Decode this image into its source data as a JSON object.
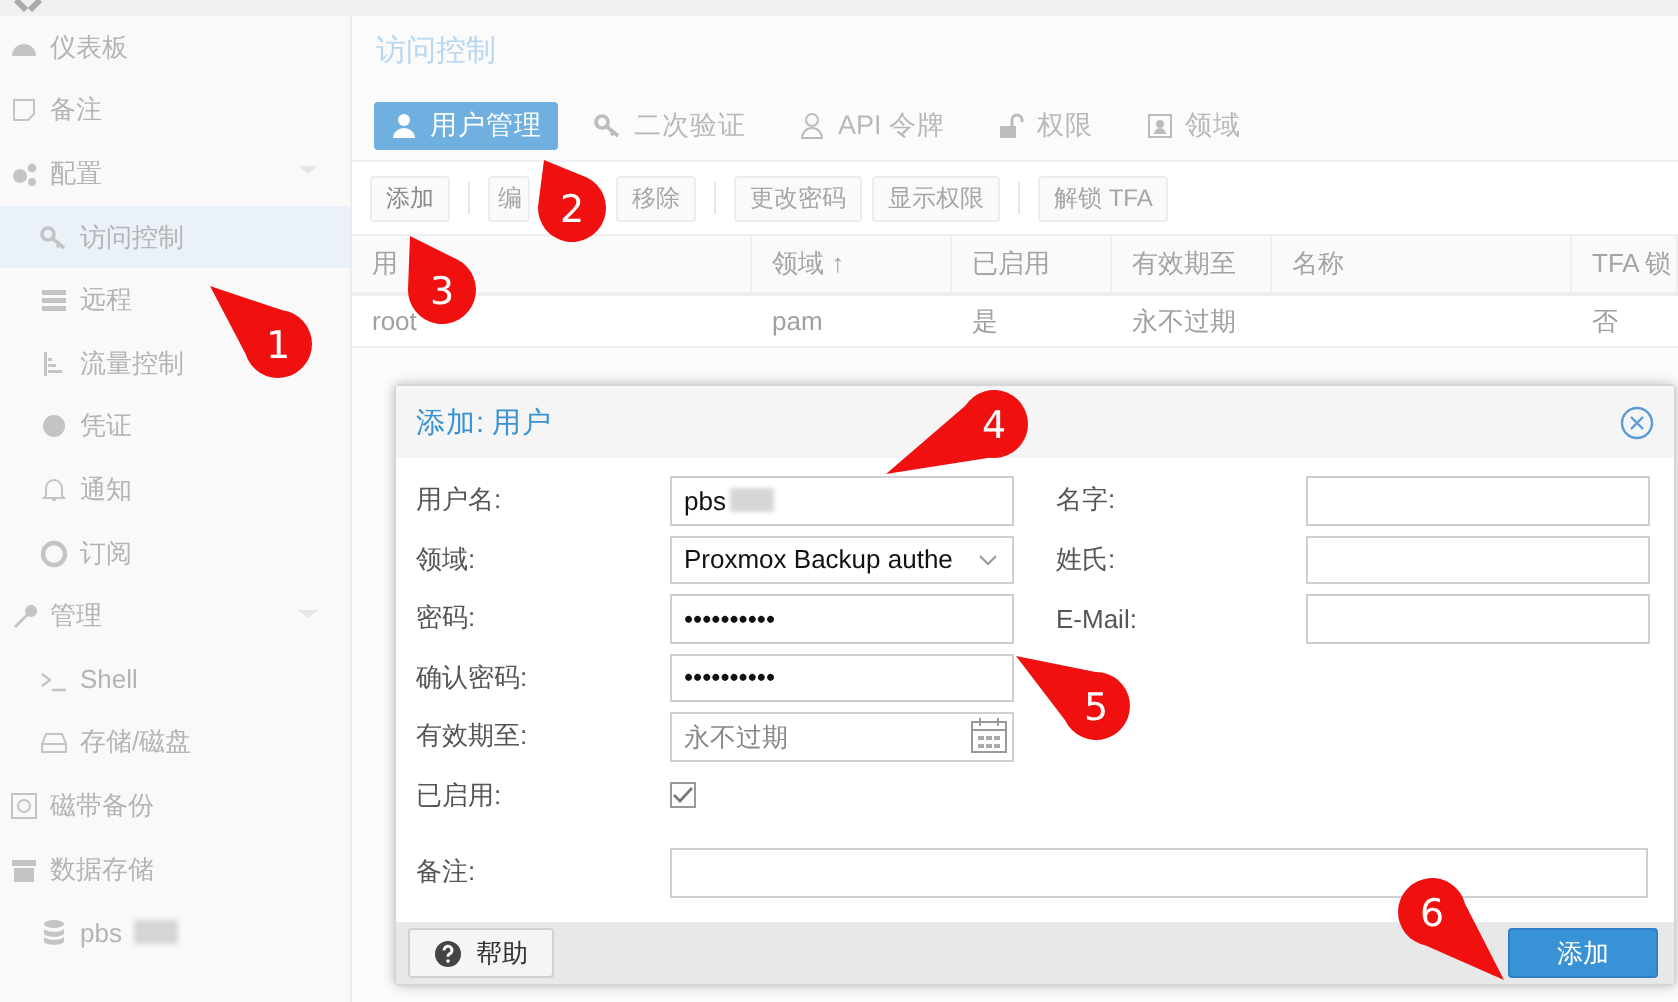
{
  "sidebar": {
    "items": [
      {
        "label": "仪表板",
        "selected": false
      },
      {
        "label": "备注",
        "selected": false
      },
      {
        "label": "配置",
        "selected": false,
        "expanded": true,
        "children": [
          {
            "label": "访问控制",
            "selected": true
          },
          {
            "label": "远程",
            "selected": false
          },
          {
            "label": "流量控制",
            "selected": false
          },
          {
            "label": "凭证",
            "selected": false
          },
          {
            "label": "通知",
            "selected": false
          },
          {
            "label": "订阅",
            "selected": false
          }
        ]
      },
      {
        "label": "管理",
        "selected": false,
        "expanded": true,
        "children": [
          {
            "label": "Shell",
            "selected": false
          },
          {
            "label": "存储/磁盘",
            "selected": false
          }
        ]
      },
      {
        "label": "磁带备份",
        "selected": false
      },
      {
        "label": "数据存储",
        "selected": false,
        "children": [
          {
            "label": "pbs",
            "selected": false,
            "redacted": true
          }
        ]
      }
    ]
  },
  "header": {
    "title": "访问控制"
  },
  "tabs": [
    {
      "label": "用户管理",
      "selected": true
    },
    {
      "label": "二次验证",
      "selected": false
    },
    {
      "label": "API 令牌",
      "selected": false
    },
    {
      "label": "权限",
      "selected": false
    },
    {
      "label": "领域",
      "selected": false
    }
  ],
  "toolbar": [
    {
      "label": "添加",
      "disabled": false,
      "separator_after": true
    },
    {
      "label": "编",
      "disabled": true,
      "separator_after": false
    },
    {
      "label": "移除",
      "disabled": true,
      "separator_after": true
    },
    {
      "label": "更改密码",
      "disabled": true,
      "separator_after": false
    },
    {
      "label": "显示权限",
      "disabled": true,
      "separator_after": true
    },
    {
      "label": "解锁 TFA",
      "disabled": true,
      "separator_after": false
    }
  ],
  "table": {
    "columns": [
      "用",
      "领域 ↑",
      "已启用",
      "有效期至",
      "名称",
      "TFA 锁"
    ],
    "rows": [
      [
        "root",
        "pam",
        "是",
        "永不过期",
        "",
        "否"
      ]
    ]
  },
  "dialog": {
    "title": "添加: 用户",
    "fields_left": [
      {
        "label": "用户名:",
        "value": "pbs",
        "kind": "text",
        "redacted": true
      },
      {
        "label": "领域:",
        "value": "Proxmox Backup authe",
        "kind": "select"
      },
      {
        "label": "密码:",
        "value": "••••••••••",
        "kind": "text"
      },
      {
        "label": "确认密码:",
        "value": "••••••••••",
        "kind": "text"
      },
      {
        "label": "有效期至:",
        "placeholder": "永不过期",
        "kind": "date"
      }
    ],
    "enabled": {
      "label": "已启用:",
      "checked": true
    },
    "fields_right": [
      {
        "label": "名字:"
      },
      {
        "label": "姓氏:"
      },
      {
        "label": "E-Mail:"
      }
    ],
    "remark": {
      "label": "备注:"
    },
    "help_button": "帮助",
    "submit_button": "添加"
  },
  "annotations": [
    {
      "number": "1"
    },
    {
      "number": "2"
    },
    {
      "number": "3"
    },
    {
      "number": "4"
    },
    {
      "number": "5"
    },
    {
      "number": "6"
    }
  ]
}
